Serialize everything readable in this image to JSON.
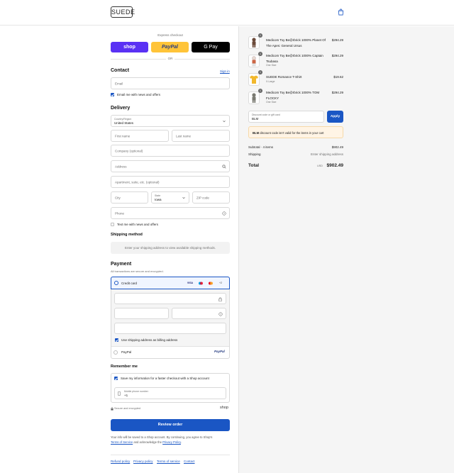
{
  "header": {
    "logo_text": "SUEDE",
    "cart_icon": "shopping-bag-icon"
  },
  "express": {
    "title": "Express checkout",
    "shop_label": "shop",
    "paypal_label": "PayPal",
    "gpay_label": "G Pay",
    "or_label": "OR",
    "colors": {
      "shop": "#5a31f4",
      "paypal": "#ffc439",
      "gpay": "#000000"
    }
  },
  "contact": {
    "title": "Contact",
    "sign_in": "Sign in",
    "email_placeholder": "Email",
    "news_label": "Email me with news and offers"
  },
  "delivery": {
    "title": "Delivery",
    "country_label": "Country/Region",
    "country_value": "United States",
    "first_name_placeholder": "First name",
    "last_name_placeholder": "Last name",
    "company_placeholder": "Company (optional)",
    "address_placeholder": "Address",
    "apartment_placeholder": "Apartment, suite, etc. (optional)",
    "city_placeholder": "City",
    "state_label": "State",
    "state_value": "Iowa",
    "zip_placeholder": "ZIP code",
    "phone_placeholder": "Phone",
    "sms_label": "Text me with news and offers"
  },
  "shipping": {
    "title": "Shipping method",
    "info": "Enter your shipping address to view available shipping methods."
  },
  "payment": {
    "title": "Payment",
    "subtitle": "All transactions are secure and encrypted.",
    "credit_card_label": "Credit card",
    "card_logos": [
      "VISA",
      "",
      "",
      "+2"
    ],
    "billing_label": "Use shipping address as billing address",
    "paypal_label": "PayPal",
    "paypal_logo": "PayPal"
  },
  "remember": {
    "title": "Remember me",
    "save_label": "Save my information for a faster checkout with a Shop account",
    "mobile_label": "Mobile phone number",
    "mobile_value": "+1",
    "secure_label": "Secure and encrypted",
    "shop_logo": "shop"
  },
  "review": {
    "button_label": "Review order",
    "legal_prefix": "Your info will be saved to a Shop account. By continuing, you agree to Shop's",
    "tos_link": "Terms of Service",
    "legal_mid": "and acknowledge the",
    "privacy_link": "Privacy Policy",
    "legal_end": "."
  },
  "footer": {
    "links": [
      "Refund policy",
      "Privacy policy",
      "Terms of service",
      "Contact"
    ]
  },
  "cart": {
    "items": [
      {
        "qty": "1",
        "name_line1": "Medicom Toy Be@rbrick 1000% Planet Of",
        "name_line2": "The Apes: General Ursus",
        "variant": "",
        "price": "$294.29",
        "thumb_color": "#6b4a3a"
      },
      {
        "qty": "1",
        "name_line1": "Medicom Toy Be@rbrick 1000% Captain",
        "name_line2": "Tsubasa",
        "variant": "One Size",
        "price": "$294.29",
        "thumb_color": "#d8c9c0"
      },
      {
        "qty": "1",
        "name_line1": "SUEDE Romance T-Shirt",
        "name_line2": "",
        "variant": "X-Large",
        "price": "$19.62",
        "thumb_color": "#f2b82c"
      },
      {
        "qty": "1",
        "name_line1": "Medicom Toy Be@rbrick 1000% TOM",
        "name_line2": "FLOCKY",
        "variant": "One Size",
        "price": "$294.29",
        "thumb_color": "#7a7a72"
      }
    ],
    "discount_label": "Discount code or gift card",
    "discount_value": "BLM",
    "apply_label": "Apply",
    "alert_code": "BLM",
    "alert_text": "discount code isn't valid for the items in your cart",
    "subtotal_label": "Subtotal · 4 items",
    "subtotal_value": "$902.49",
    "shipping_label": "Shipping",
    "shipping_value": "Enter shipping address",
    "total_label": "Total",
    "currency": "USD",
    "total_value": "$902.49"
  }
}
